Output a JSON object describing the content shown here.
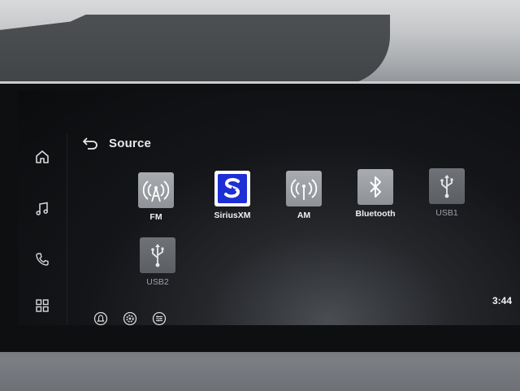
{
  "header": {
    "title": "Source"
  },
  "sidebar": {
    "items": [
      {
        "icon": "home-icon"
      },
      {
        "icon": "music-note-icon"
      },
      {
        "icon": "phone-icon"
      },
      {
        "icon": "grid-apps-icon"
      }
    ]
  },
  "sources": [
    {
      "label": "FM",
      "icon": "radio-antenna-icon",
      "enabled": true
    },
    {
      "label": "SiriusXM",
      "icon": "siriusxm-logo-icon",
      "enabled": true
    },
    {
      "label": "AM",
      "icon": "radio-antenna-icon",
      "enabled": true
    },
    {
      "label": "Bluetooth",
      "icon": "bluetooth-icon",
      "enabled": true
    },
    {
      "label": "USB1",
      "icon": "usb-icon",
      "enabled": false
    },
    {
      "label": "USB2",
      "icon": "usb-icon",
      "enabled": false
    }
  ],
  "toolbar": {
    "buttons": [
      {
        "icon": "alert-bell-icon"
      },
      {
        "icon": "settings-gear-icon"
      },
      {
        "icon": "equalizer-icon"
      }
    ]
  },
  "status": {
    "time": "3:44"
  },
  "colors": {
    "sirius_blue": "#1f2fd6",
    "screen_bg": "#0b0c0e"
  }
}
